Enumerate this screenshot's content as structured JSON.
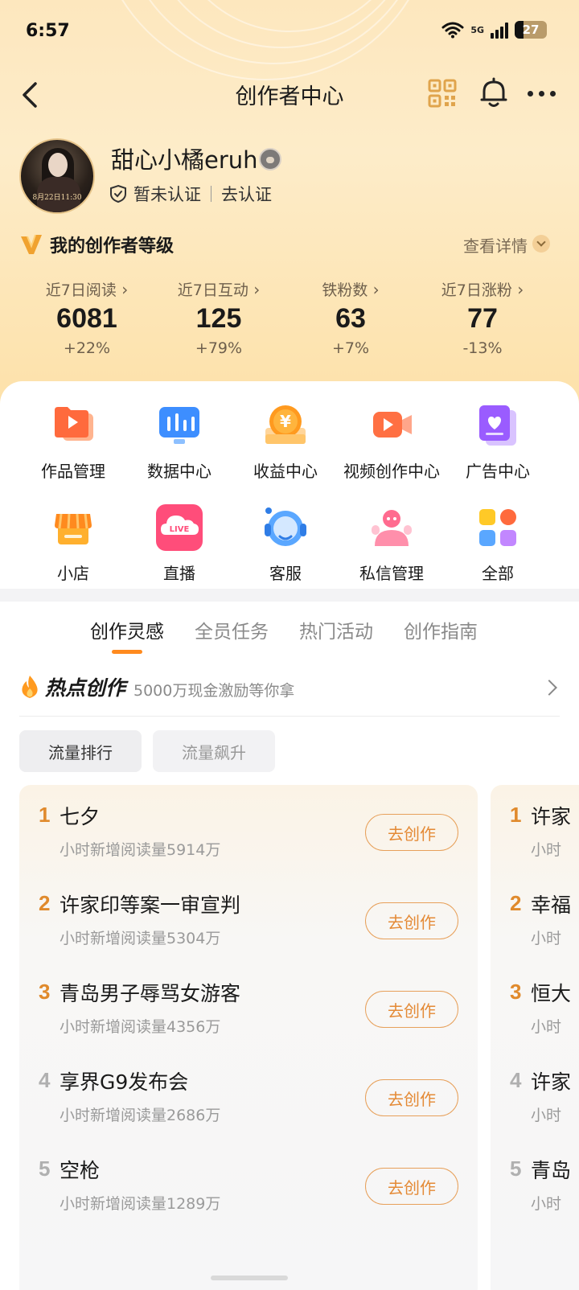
{
  "status_bar": {
    "time": "6:57",
    "network": "5G",
    "battery": "27"
  },
  "nav": {
    "title": "创作者中心"
  },
  "profile": {
    "username": "甜心小橘eruh",
    "avatar_caption": "8月22日11:30",
    "cert_status": "暂未认证",
    "cert_action": "去认证"
  },
  "level": {
    "title": "我的创作者等级",
    "detail": "查看详情"
  },
  "stats": [
    {
      "label": "近7日阅读",
      "value": "6081",
      "delta": "+22%"
    },
    {
      "label": "近7日互动",
      "value": "125",
      "delta": "+79%"
    },
    {
      "label": "铁粉数",
      "value": "63",
      "delta": "+7%"
    },
    {
      "label": "近7日涨粉",
      "value": "77",
      "delta": "-13%"
    }
  ],
  "tools": [
    {
      "label": "作品管理",
      "icon": "works-icon"
    },
    {
      "label": "数据中心",
      "icon": "data-icon"
    },
    {
      "label": "收益中心",
      "icon": "income-icon"
    },
    {
      "label": "视频创作中心",
      "icon": "video-icon"
    },
    {
      "label": "广告中心",
      "icon": "ad-icon"
    },
    {
      "label": "小店",
      "icon": "shop-icon"
    },
    {
      "label": "直播",
      "icon": "live-icon",
      "badge": "LIVE"
    },
    {
      "label": "客服",
      "icon": "service-icon"
    },
    {
      "label": "私信管理",
      "icon": "message-icon"
    },
    {
      "label": "全部",
      "icon": "all-icon"
    }
  ],
  "tabs": [
    {
      "label": "创作灵感",
      "active": true
    },
    {
      "label": "全员任务",
      "active": false
    },
    {
      "label": "热门活动",
      "active": false
    },
    {
      "label": "创作指南",
      "active": false
    }
  ],
  "hot": {
    "title": "热点创作",
    "subtitle": "5000万现金激励等你拿"
  },
  "filters": [
    {
      "label": "流量排行",
      "active": true
    },
    {
      "label": "流量飙升",
      "active": false
    }
  ],
  "ranking": [
    {
      "rank": "1",
      "title": "七夕",
      "sub": "小时新增阅读量5914万",
      "button": "去创作"
    },
    {
      "rank": "2",
      "title": "许家印等案一审宣判",
      "sub": "小时新增阅读量5304万",
      "button": "去创作"
    },
    {
      "rank": "3",
      "title": "青岛男子辱骂女游客",
      "sub": "小时新增阅读量4356万",
      "button": "去创作"
    },
    {
      "rank": "4",
      "title": "享界G9发布会",
      "sub": "小时新增阅读量2686万",
      "button": "去创作"
    },
    {
      "rank": "5",
      "title": "空枪",
      "sub": "小时新增阅读量1289万",
      "button": "去创作"
    }
  ],
  "ranking2": [
    {
      "rank": "1",
      "title": "许家",
      "sub": "小时"
    },
    {
      "rank": "2",
      "title": "幸福",
      "sub": "小时"
    },
    {
      "rank": "3",
      "title": "恒大",
      "sub": "小时"
    },
    {
      "rank": "4",
      "title": "许家",
      "sub": "小时"
    },
    {
      "rank": "5",
      "title": "青岛",
      "sub": "小时"
    }
  ],
  "colors": {
    "accent": "#ff8a1e",
    "header_bg": "#fde7be",
    "rank_top": "#e08a2c"
  }
}
